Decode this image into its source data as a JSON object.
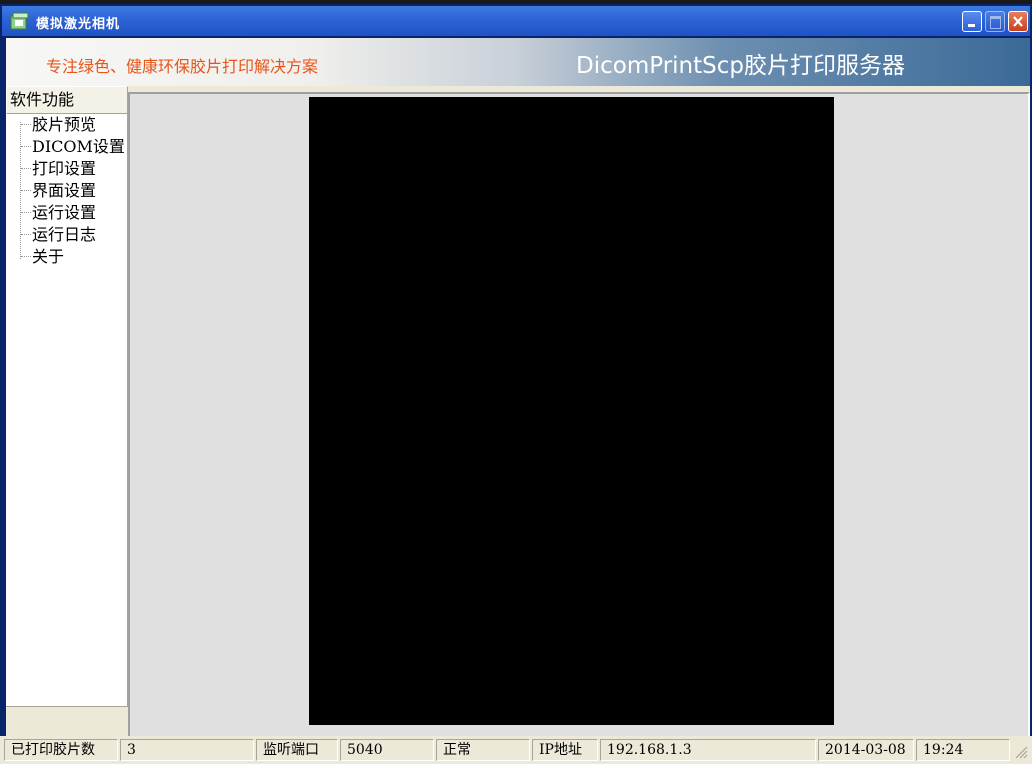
{
  "window": {
    "title": "模拟激光相机"
  },
  "banner": {
    "slogan": "专注绿色、健康环保胶片打印解决方案",
    "product": "DicomPrintScp胶片打印服务器"
  },
  "sidebar": {
    "header": "软件功能",
    "items": [
      "胶片预览",
      "DICOM设置",
      "打印设置",
      "界面设置",
      "运行设置",
      "运行日志",
      "关于"
    ]
  },
  "statusbar": {
    "printed_label": "已打印胶片数",
    "printed_value": "3",
    "port_label": "监听端口",
    "port_value": "5040",
    "state": "正常",
    "ip_label": "IP地址",
    "ip_value": "192.168.1.3",
    "date": "2014-03-08",
    "time": "19:24"
  },
  "colors": {
    "slogan": "#e8551a",
    "titlebar": "#2d63d6",
    "film": "#000000"
  }
}
